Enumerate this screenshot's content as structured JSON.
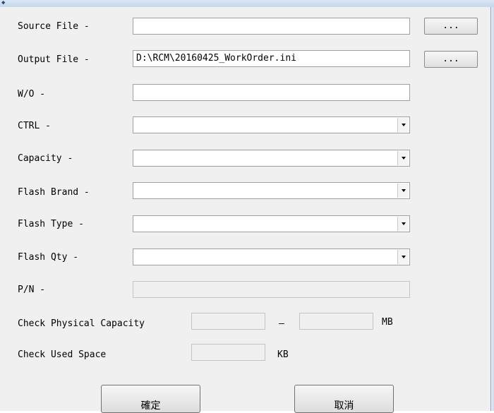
{
  "window": {
    "icon": "app-icon"
  },
  "form": {
    "source_file": {
      "label": "Source File -",
      "value": "",
      "browse_label": "..."
    },
    "output_file": {
      "label": "Output File -",
      "value": "D:\\RCM\\20160425_WorkOrder.ini",
      "browse_label": "..."
    },
    "wo": {
      "label": "W/O -",
      "value": ""
    },
    "ctrl": {
      "label": "CTRL -",
      "value": ""
    },
    "capacity": {
      "label": "Capacity -",
      "value": ""
    },
    "flash_brand": {
      "label": "Flash Brand -",
      "value": ""
    },
    "flash_type": {
      "label": "Flash Type -",
      "value": ""
    },
    "flash_qty": {
      "label": "Flash Qty -",
      "value": ""
    },
    "pn": {
      "label": "P/N -",
      "value": ""
    },
    "check_physical_capacity": {
      "label": "Check Physical Capacity",
      "min": "",
      "separator": "—",
      "max": "",
      "unit": "MB"
    },
    "check_used_space": {
      "label": "Check Used Space",
      "value": "",
      "unit": "KB"
    }
  },
  "buttons": {
    "ok": "確定",
    "cancel": "取消"
  }
}
